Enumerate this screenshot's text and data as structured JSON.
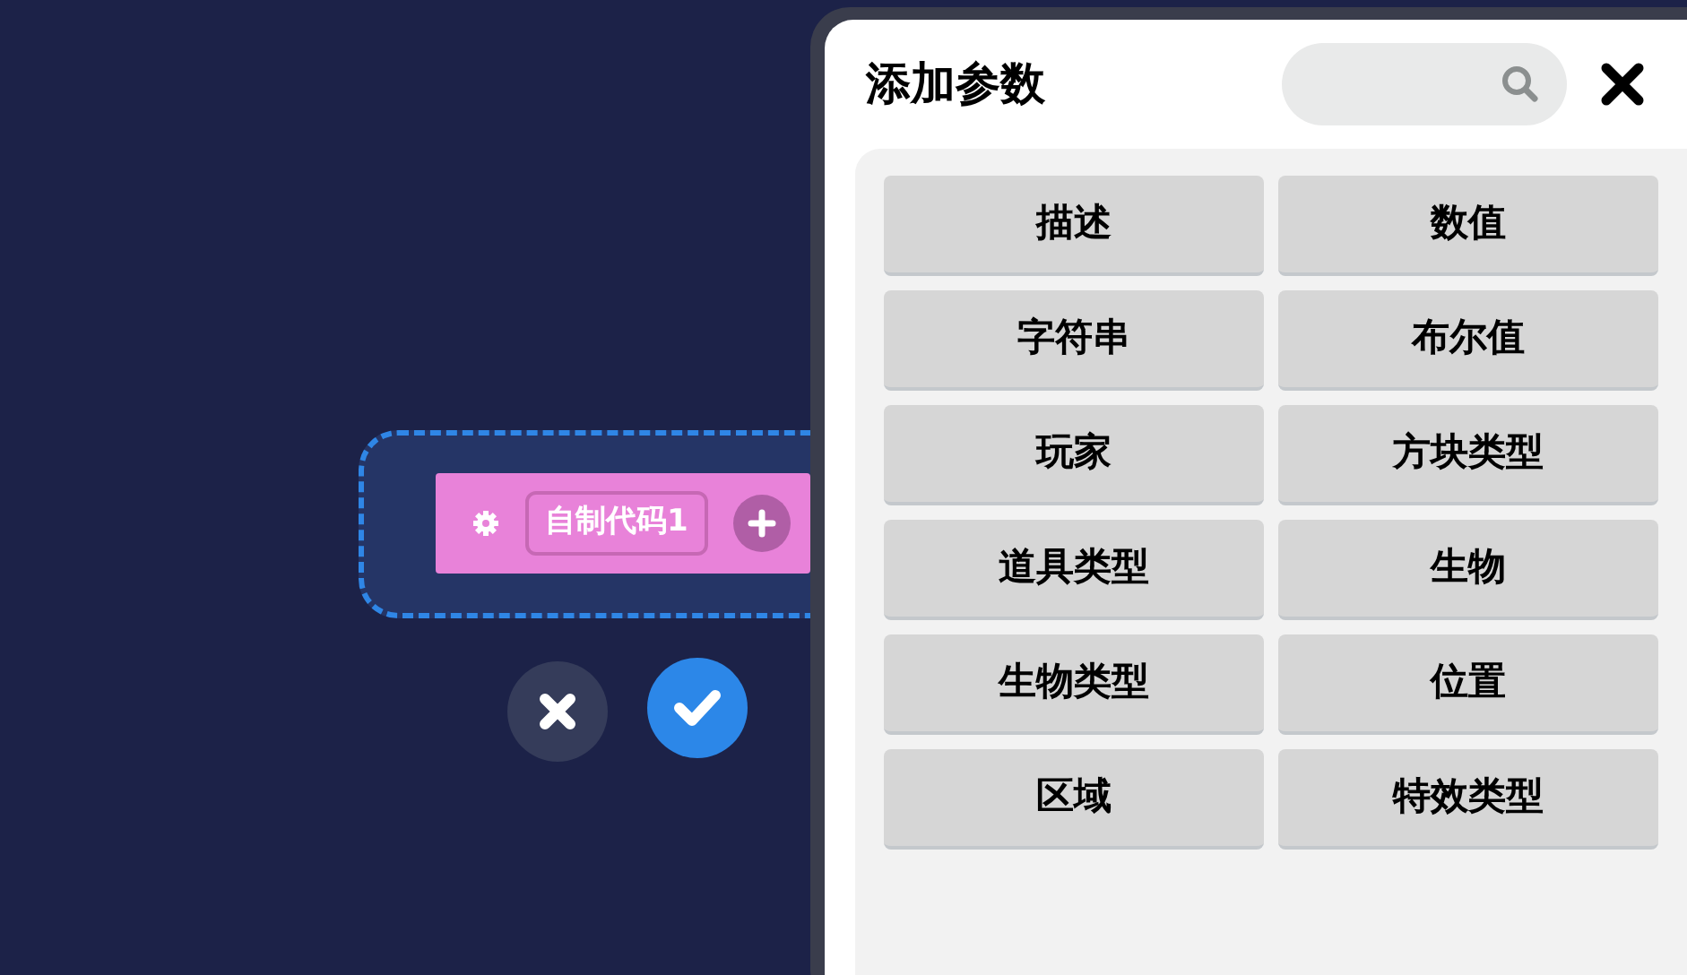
{
  "block": {
    "name": "自制代码1"
  },
  "panel": {
    "title": "添加参数",
    "options": [
      "描述",
      "数值",
      "字符串",
      "布尔值",
      "玩家",
      "方块类型",
      "道具类型",
      "生物",
      "生物类型",
      "位置",
      "区域",
      "特效类型"
    ]
  }
}
